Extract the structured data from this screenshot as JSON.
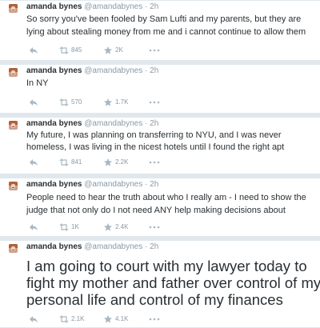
{
  "tweets": [
    {
      "name": "amanda bynes",
      "handle": "@amandabynes",
      "sep": "·",
      "time": "2h",
      "lines": [
        "So sorry you've been fooled by Sam Lufti and my parents, but they are",
        "lying about stealing money from me and i cannot continue to allow them"
      ],
      "retweets": "845",
      "favorites": "2K"
    },
    {
      "name": "amanda bynes",
      "handle": "@amandabynes",
      "sep": "·",
      "time": "2h",
      "lines": [
        "In NY"
      ],
      "retweets": "570",
      "favorites": "1.7K"
    },
    {
      "name": "amanda bynes",
      "handle": "@amandabynes",
      "sep": "·",
      "time": "2h",
      "lines": [
        "My future, I was planning on transferring to NYU, and I was never",
        "homeless, I was living in the nicest hotels until I found the right apt"
      ],
      "retweets": "841",
      "favorites": "2.2K"
    },
    {
      "name": "amanda bynes",
      "handle": "@amandabynes",
      "sep": "·",
      "time": "2h",
      "lines": [
        "People need to hear the truth about who I really am - I need to show the",
        "judge that not only do I not need ANY help making decisions about"
      ],
      "retweets": "1K",
      "favorites": "2.4K"
    },
    {
      "name": "amanda bynes",
      "handle": "@amandabynes",
      "sep": "·",
      "time": "2h",
      "lines": [
        "I am going to court with my lawyer today to",
        "fight my mother and father over control of my",
        "personal life and control of my finances"
      ],
      "retweets": "2.1K",
      "favorites": "4.1K"
    }
  ],
  "icons": {
    "reply": "reply-icon",
    "retweet": "retweet-icon",
    "favorite": "star-icon",
    "more": "more-dots-icon"
  },
  "colors": {
    "text": "#292f33",
    "muted": "#8899a6",
    "background": "#e1e8ed"
  }
}
